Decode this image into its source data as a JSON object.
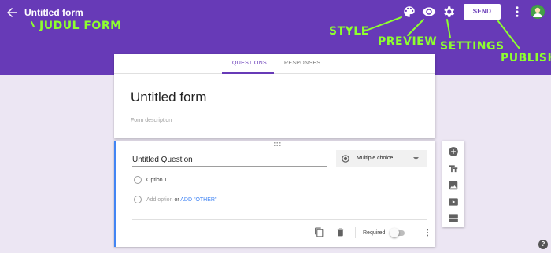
{
  "topbar": {
    "title": "Untitled form",
    "send_label": "SEND",
    "color": "#673ab7",
    "icons": [
      "arrow-back-icon",
      "palette-icon",
      "eye-icon",
      "gear-icon",
      "more-vert-icon"
    ]
  },
  "annotations": {
    "judul_form": "JUDUL FORM",
    "style": "STYLE",
    "preview": "PREVIEW",
    "settings": "SETTINGS",
    "publish": "PUBLISH",
    "color": "#8dff2f"
  },
  "tabs": [
    {
      "label": "QUESTIONS",
      "active": true
    },
    {
      "label": "RESPONSES",
      "active": false
    }
  ],
  "form": {
    "title": "Untitled form",
    "description_placeholder": "Form description"
  },
  "question": {
    "title": "Untitled Question",
    "type": "Multiple choice",
    "option1": "Option 1",
    "add_option": "Add option",
    "or": "or",
    "add_other": "ADD \"OTHER\"",
    "required_label": "Required",
    "accent_color": "#4285f4"
  },
  "side_toolbar": {
    "icons": [
      "add-circle-icon",
      "title-icon",
      "image-icon",
      "video-icon",
      "section-icon"
    ]
  },
  "help": {
    "label": "?"
  }
}
